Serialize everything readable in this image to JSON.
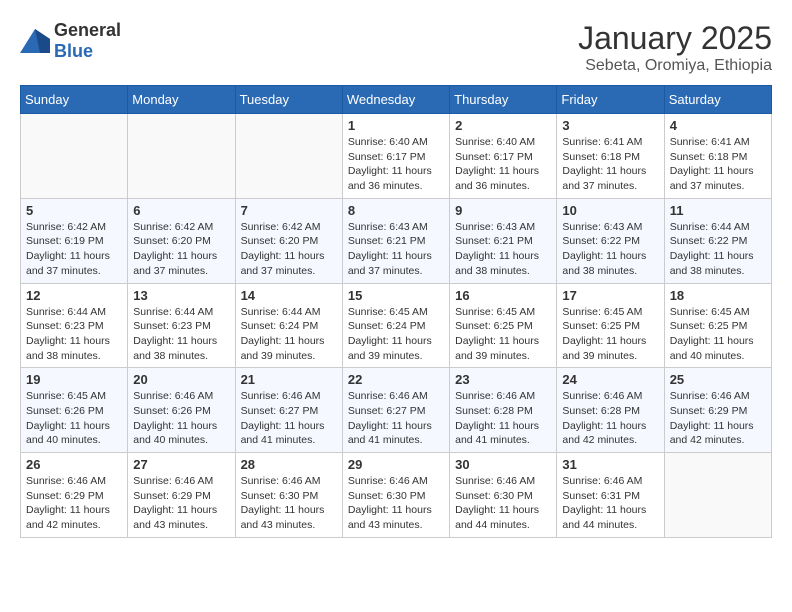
{
  "logo": {
    "text_general": "General",
    "text_blue": "Blue"
  },
  "title": "January 2025",
  "subtitle": "Sebeta, Oromiya, Ethiopia",
  "weekdays": [
    "Sunday",
    "Monday",
    "Tuesday",
    "Wednesday",
    "Thursday",
    "Friday",
    "Saturday"
  ],
  "weeks": [
    [
      {
        "day": "",
        "info": ""
      },
      {
        "day": "",
        "info": ""
      },
      {
        "day": "",
        "info": ""
      },
      {
        "day": "1",
        "info": "Sunrise: 6:40 AM\nSunset: 6:17 PM\nDaylight: 11 hours\nand 36 minutes."
      },
      {
        "day": "2",
        "info": "Sunrise: 6:40 AM\nSunset: 6:17 PM\nDaylight: 11 hours\nand 36 minutes."
      },
      {
        "day": "3",
        "info": "Sunrise: 6:41 AM\nSunset: 6:18 PM\nDaylight: 11 hours\nand 37 minutes."
      },
      {
        "day": "4",
        "info": "Sunrise: 6:41 AM\nSunset: 6:18 PM\nDaylight: 11 hours\nand 37 minutes."
      }
    ],
    [
      {
        "day": "5",
        "info": "Sunrise: 6:42 AM\nSunset: 6:19 PM\nDaylight: 11 hours\nand 37 minutes."
      },
      {
        "day": "6",
        "info": "Sunrise: 6:42 AM\nSunset: 6:20 PM\nDaylight: 11 hours\nand 37 minutes."
      },
      {
        "day": "7",
        "info": "Sunrise: 6:42 AM\nSunset: 6:20 PM\nDaylight: 11 hours\nand 37 minutes."
      },
      {
        "day": "8",
        "info": "Sunrise: 6:43 AM\nSunset: 6:21 PM\nDaylight: 11 hours\nand 37 minutes."
      },
      {
        "day": "9",
        "info": "Sunrise: 6:43 AM\nSunset: 6:21 PM\nDaylight: 11 hours\nand 38 minutes."
      },
      {
        "day": "10",
        "info": "Sunrise: 6:43 AM\nSunset: 6:22 PM\nDaylight: 11 hours\nand 38 minutes."
      },
      {
        "day": "11",
        "info": "Sunrise: 6:44 AM\nSunset: 6:22 PM\nDaylight: 11 hours\nand 38 minutes."
      }
    ],
    [
      {
        "day": "12",
        "info": "Sunrise: 6:44 AM\nSunset: 6:23 PM\nDaylight: 11 hours\nand 38 minutes."
      },
      {
        "day": "13",
        "info": "Sunrise: 6:44 AM\nSunset: 6:23 PM\nDaylight: 11 hours\nand 38 minutes."
      },
      {
        "day": "14",
        "info": "Sunrise: 6:44 AM\nSunset: 6:24 PM\nDaylight: 11 hours\nand 39 minutes."
      },
      {
        "day": "15",
        "info": "Sunrise: 6:45 AM\nSunset: 6:24 PM\nDaylight: 11 hours\nand 39 minutes."
      },
      {
        "day": "16",
        "info": "Sunrise: 6:45 AM\nSunset: 6:25 PM\nDaylight: 11 hours\nand 39 minutes."
      },
      {
        "day": "17",
        "info": "Sunrise: 6:45 AM\nSunset: 6:25 PM\nDaylight: 11 hours\nand 39 minutes."
      },
      {
        "day": "18",
        "info": "Sunrise: 6:45 AM\nSunset: 6:25 PM\nDaylight: 11 hours\nand 40 minutes."
      }
    ],
    [
      {
        "day": "19",
        "info": "Sunrise: 6:45 AM\nSunset: 6:26 PM\nDaylight: 11 hours\nand 40 minutes."
      },
      {
        "day": "20",
        "info": "Sunrise: 6:46 AM\nSunset: 6:26 PM\nDaylight: 11 hours\nand 40 minutes."
      },
      {
        "day": "21",
        "info": "Sunrise: 6:46 AM\nSunset: 6:27 PM\nDaylight: 11 hours\nand 41 minutes."
      },
      {
        "day": "22",
        "info": "Sunrise: 6:46 AM\nSunset: 6:27 PM\nDaylight: 11 hours\nand 41 minutes."
      },
      {
        "day": "23",
        "info": "Sunrise: 6:46 AM\nSunset: 6:28 PM\nDaylight: 11 hours\nand 41 minutes."
      },
      {
        "day": "24",
        "info": "Sunrise: 6:46 AM\nSunset: 6:28 PM\nDaylight: 11 hours\nand 42 minutes."
      },
      {
        "day": "25",
        "info": "Sunrise: 6:46 AM\nSunset: 6:29 PM\nDaylight: 11 hours\nand 42 minutes."
      }
    ],
    [
      {
        "day": "26",
        "info": "Sunrise: 6:46 AM\nSunset: 6:29 PM\nDaylight: 11 hours\nand 42 minutes."
      },
      {
        "day": "27",
        "info": "Sunrise: 6:46 AM\nSunset: 6:29 PM\nDaylight: 11 hours\nand 43 minutes."
      },
      {
        "day": "28",
        "info": "Sunrise: 6:46 AM\nSunset: 6:30 PM\nDaylight: 11 hours\nand 43 minutes."
      },
      {
        "day": "29",
        "info": "Sunrise: 6:46 AM\nSunset: 6:30 PM\nDaylight: 11 hours\nand 43 minutes."
      },
      {
        "day": "30",
        "info": "Sunrise: 6:46 AM\nSunset: 6:30 PM\nDaylight: 11 hours\nand 44 minutes."
      },
      {
        "day": "31",
        "info": "Sunrise: 6:46 AM\nSunset: 6:31 PM\nDaylight: 11 hours\nand 44 minutes."
      },
      {
        "day": "",
        "info": ""
      }
    ]
  ]
}
